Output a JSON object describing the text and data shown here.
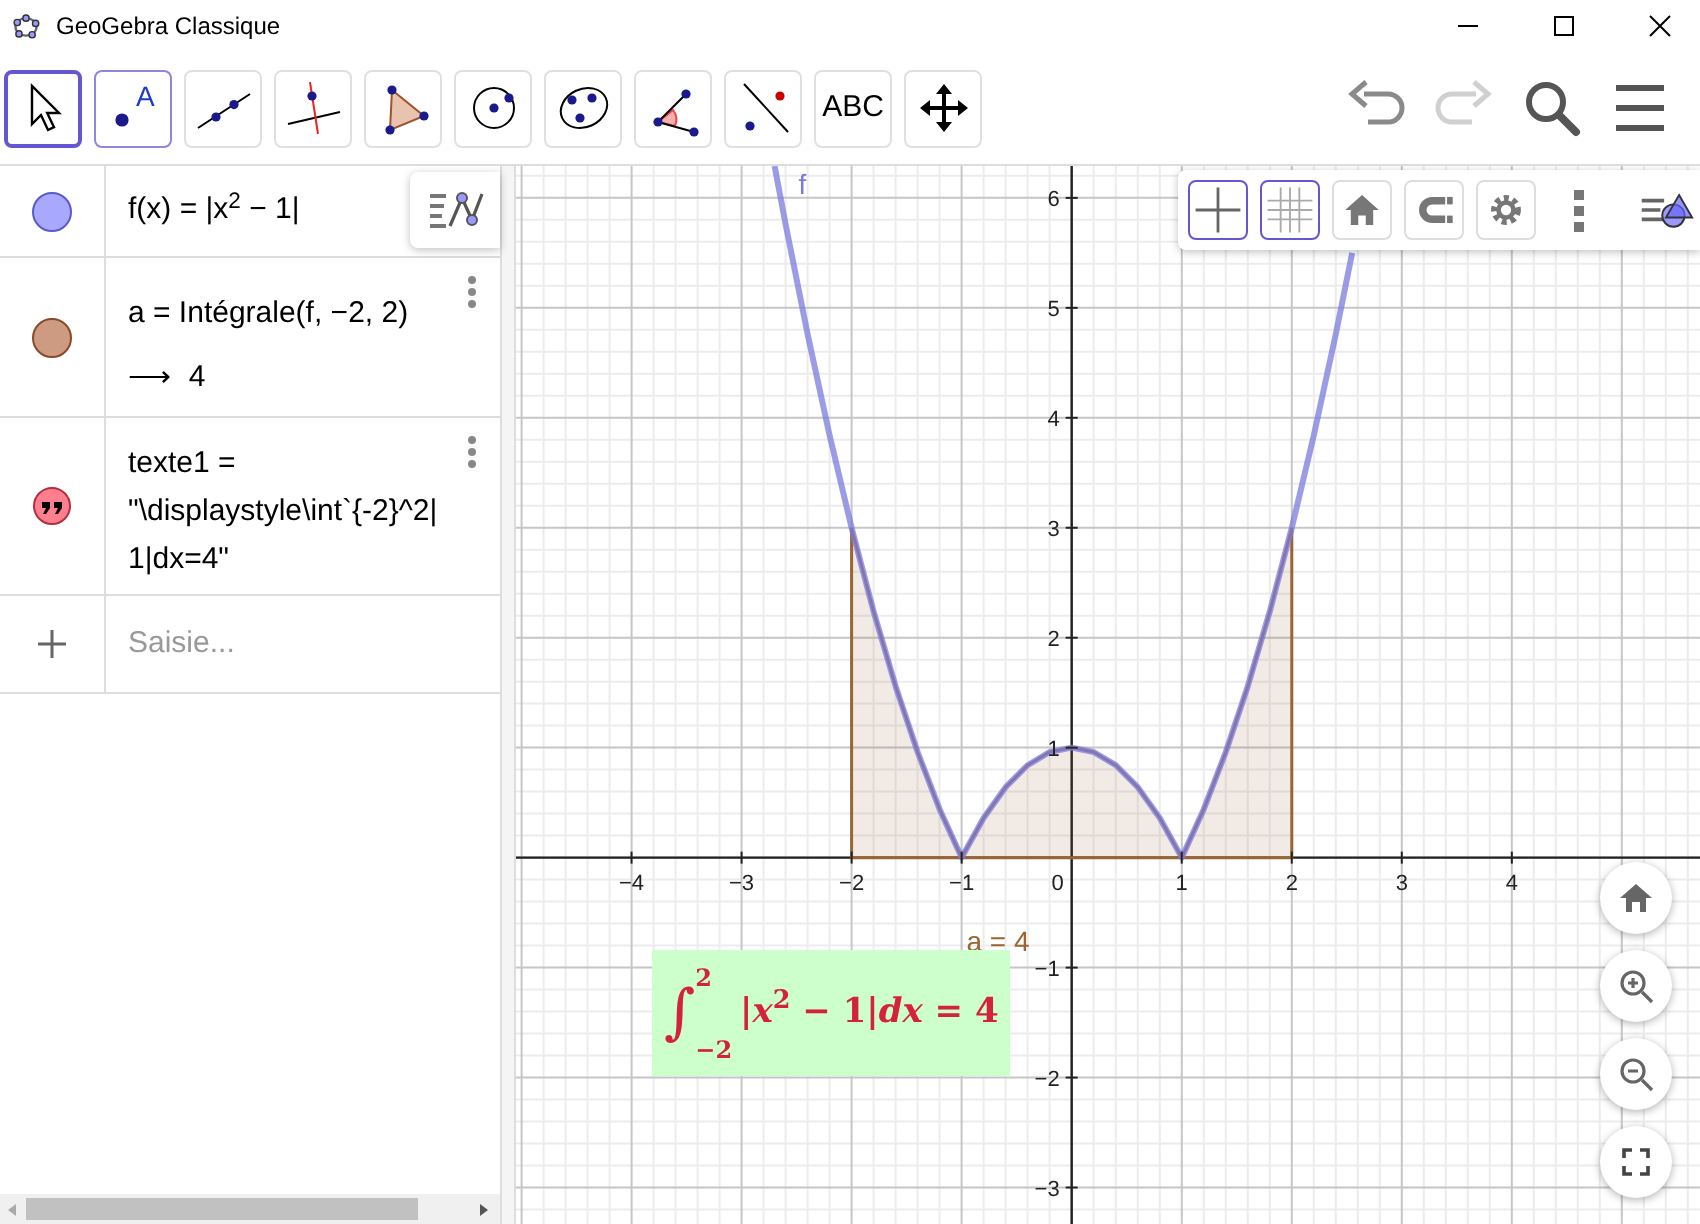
{
  "window": {
    "title": "GeoGebra Classique"
  },
  "toolbar": {
    "tools": [
      {
        "kind": "move",
        "selected": true,
        "hover": false
      },
      {
        "kind": "point",
        "label": "A",
        "selected": false,
        "hover": true
      },
      {
        "kind": "line",
        "selected": false,
        "hover": false
      },
      {
        "kind": "perpendicular",
        "selected": false,
        "hover": false
      },
      {
        "kind": "polygon",
        "selected": false,
        "hover": false
      },
      {
        "kind": "circle",
        "selected": false,
        "hover": false
      },
      {
        "kind": "conic",
        "selected": false,
        "hover": false
      },
      {
        "kind": "angle",
        "selected": false,
        "hover": false
      },
      {
        "kind": "reflect",
        "selected": false,
        "hover": false
      },
      {
        "kind": "text",
        "label": "ABC",
        "selected": false,
        "hover": false
      },
      {
        "kind": "pan",
        "selected": false,
        "hover": false
      }
    ],
    "actions": [
      {
        "kind": "undo",
        "disabled": false
      },
      {
        "kind": "redo",
        "disabled": true
      },
      {
        "kind": "search",
        "disabled": false
      },
      {
        "kind": "menu",
        "disabled": false
      }
    ]
  },
  "algebra": {
    "items": [
      {
        "kind": "function",
        "color": "#a8a8ff",
        "lines": [
          "f(x) = |x$^{2}$ − 1|"
        ],
        "menu": false
      },
      {
        "kind": "value",
        "color": "#cc9b82",
        "lines": [
          "a = Intégrale(f, −2, 2)",
          "⟶  4"
        ],
        "menu": true
      },
      {
        "kind": "text",
        "color": "#ff7f8f",
        "lines": [
          "texte1 =",
          "\"\\displaystyle\\int`{-2}^2|",
          "1|dx=4\""
        ],
        "menu": true
      }
    ],
    "input": {
      "placeholder": "Saisie..."
    }
  },
  "graphics": {
    "style_bar": [
      {
        "kind": "axes",
        "selected": true
      },
      {
        "kind": "grid",
        "selected": true
      },
      {
        "kind": "home",
        "selected": false
      },
      {
        "kind": "magnet",
        "selected": false
      },
      {
        "kind": "settings",
        "selected": false
      },
      {
        "kind": "more",
        "selected": false
      },
      {
        "kind": "toggle",
        "selected": false
      }
    ],
    "chart_data": {
      "type": "line",
      "grid": true,
      "x": [
        -2.7,
        -2.6,
        -2.4,
        -2.2,
        -2,
        -1.8,
        -1.6,
        -1.4,
        -1.2,
        -1,
        -0.8,
        -0.6,
        -0.4,
        -0.2,
        0,
        0.2,
        0.4,
        0.6,
        0.8,
        1,
        1.2,
        1.4,
        1.6,
        1.8,
        2,
        2.2,
        2.4,
        2.55
      ],
      "series": [
        {
          "name": "f",
          "color": "#7b7bdd",
          "values": [
            6.29,
            5.76,
            4.76,
            3.84,
            3,
            2.24,
            1.56,
            0.96,
            0.44,
            0,
            0.36,
            0.64,
            0.84,
            0.96,
            1,
            0.96,
            0.84,
            0.64,
            0.36,
            0,
            0.44,
            0.96,
            1.56,
            2.24,
            3,
            3.84,
            4.76,
            5.5
          ]
        },
        {
          "name": "a = 4",
          "type": "area",
          "color": "#996633",
          "values": [
            null,
            null,
            null,
            null,
            3,
            2.24,
            1.56,
            0.96,
            0.44,
            0,
            0.36,
            0.64,
            0.84,
            0.96,
            1,
            0.96,
            0.84,
            0.64,
            0.36,
            0,
            0.44,
            0.96,
            1.56,
            2.24,
            3,
            null,
            null,
            null
          ]
        }
      ],
      "xlim": [
        -5.05,
        5.71
      ],
      "ylim": [
        -3.35,
        6.29
      ],
      "xticks": [
        {
          "value": -4,
          "label": "−4"
        },
        {
          "value": -3,
          "label": "−3"
        },
        {
          "value": -2,
          "label": "−2"
        },
        {
          "value": -1,
          "label": "−1"
        },
        {
          "value": 1,
          "label": "1"
        },
        {
          "value": 2,
          "label": "2"
        },
        {
          "value": 3,
          "label": "3"
        },
        {
          "value": 4,
          "label": "4"
        }
      ],
      "yticks": [
        {
          "value": -3,
          "label": "−3"
        },
        {
          "value": -2,
          "label": "−2"
        },
        {
          "value": -1,
          "label": "−1"
        },
        {
          "value": 1,
          "label": "1"
        },
        {
          "value": 2,
          "label": "2"
        },
        {
          "value": 3,
          "label": "3"
        },
        {
          "value": 4,
          "label": "4"
        },
        {
          "value": 5,
          "label": "5"
        },
        {
          "value": 6,
          "label": "6"
        }
      ]
    },
    "origin_label": "0",
    "text_box": {
      "integral_sign": "∫",
      "upper": "2",
      "lower": "−2",
      "body": "|*x*$^{2}$ − 1|*dx* = 4"
    }
  }
}
